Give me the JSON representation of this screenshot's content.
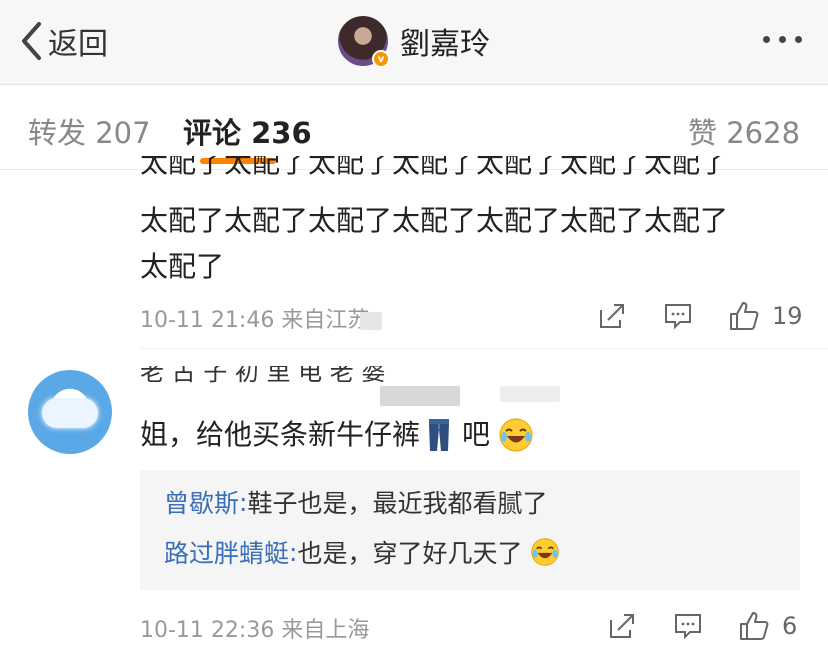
{
  "header": {
    "back_label": "返回",
    "user_name": "劉嘉玲",
    "verified_badge": "v"
  },
  "tabs": [
    {
      "label": "转发 207",
      "active": false
    },
    {
      "label": "评论 236",
      "active": true
    },
    {
      "label": "赞 2628",
      "active": false
    }
  ],
  "accent_color": "#ff8200",
  "comments": [
    {
      "text_line1": "太配了太配了太配了太配了太配了太配了太配了",
      "text_line2": "太配了太配了太配了太配了太配了太配了太配了",
      "text_line3": "太配了",
      "meta": "10-11 21:46  来自江苏",
      "likes": "19"
    },
    {
      "commenter": "老 古 子 初 里 电 老 婆",
      "text": "姐，给他买条新牛仔裤",
      "text_after": "吧",
      "replies": [
        {
          "name": "曾歇斯",
          "sep": ":",
          "text": " 鞋子也是，最近我都看腻了"
        },
        {
          "name": "路过胖蜻蜓",
          "sep": ":",
          "text": " 也是，穿了好几天了"
        }
      ],
      "meta": "10-11 22:36  来自上海",
      "likes": "6"
    }
  ],
  "icons": [
    "back-chevron-icon",
    "more-dots-icon",
    "share-icon",
    "comment-icon",
    "like-icon",
    "jeans-emoji-icon",
    "laugh-cry-emoji-icon"
  ]
}
